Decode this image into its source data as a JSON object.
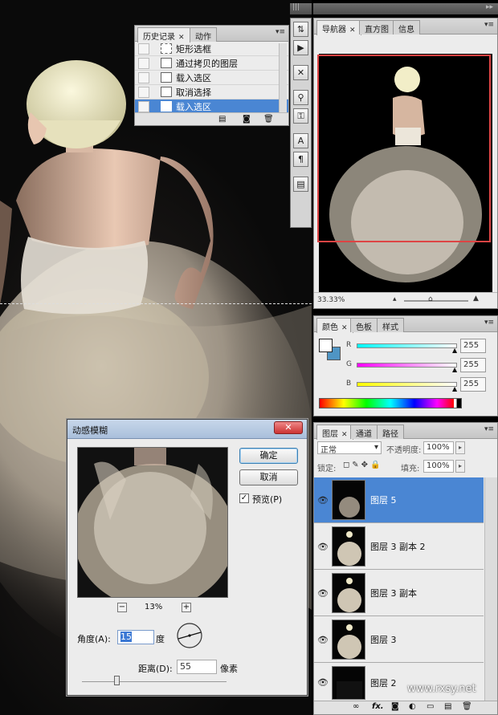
{
  "history": {
    "tabs": [
      "历史记录",
      "动作"
    ],
    "items": [
      "矩形选框",
      "通过拷贝的图层",
      "载入选区",
      "取消选择",
      "载入选区"
    ],
    "selected_index": 4
  },
  "navigator": {
    "tabs": [
      "导航器",
      "直方图",
      "信息"
    ],
    "zoom": "33.33%"
  },
  "color": {
    "tabs": [
      "颜色",
      "色板",
      "样式"
    ],
    "channels": [
      {
        "label": "R",
        "value": "255"
      },
      {
        "label": "G",
        "value": "255"
      },
      {
        "label": "B",
        "value": "255"
      }
    ],
    "foreground": "#ffffff",
    "background": "#4f95c4"
  },
  "layers": {
    "tabs": [
      "图层",
      "通道",
      "路径"
    ],
    "blend_mode": "正常",
    "opacity_label": "不透明度:",
    "opacity_value": "100%",
    "lock_label": "锁定:",
    "fill_label": "填充:",
    "fill_value": "100%",
    "items": [
      {
        "name": "图层 5",
        "selected": true
      },
      {
        "name": "图层 3 副本 2",
        "selected": false
      },
      {
        "name": "图层 3 副本",
        "selected": false
      },
      {
        "name": "图层 3",
        "selected": false
      },
      {
        "name": "图层 2",
        "selected": false
      }
    ],
    "footer_fx": "fx."
  },
  "dialog": {
    "title": "动感模糊",
    "ok_label": "确定",
    "cancel_label": "取消",
    "preview_label": "预览(P)",
    "preview_checked": true,
    "zoom_value": "13%",
    "angle_label": "角度(A):",
    "angle_value": "15",
    "angle_unit": "度",
    "distance_label": "距离(D):",
    "distance_value": "55",
    "distance_unit": "像素"
  },
  "watermark": "www.rxsy.net"
}
